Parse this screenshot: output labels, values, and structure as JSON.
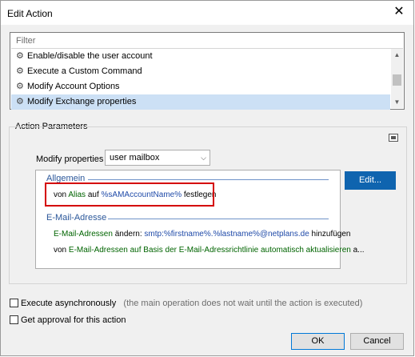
{
  "window": {
    "title": "Edit Action",
    "close_glyph": "✕"
  },
  "action_list": {
    "filter_placeholder": "Filter",
    "items": [
      {
        "label": "Enable/disable the user account",
        "selected": false
      },
      {
        "label": "Execute a Custom Command",
        "selected": false
      },
      {
        "label": "Modify Account Options",
        "selected": false
      },
      {
        "label": "Modify Exchange properties",
        "selected": true
      }
    ]
  },
  "params": {
    "group_label": "Action Parameters",
    "modify_label": "Modify properties of",
    "modify_value": "user mailbox",
    "sections": {
      "allgemein": {
        "title": "Allgemein",
        "line": {
          "p1": "von ",
          "p2": "Alias",
          "p3": " auf ",
          "p4": "%sAMAccountName%",
          "p5": " festlegen"
        }
      },
      "email": {
        "title": "E-Mail-Adresse",
        "line1": {
          "p1": "E-Mail-Adressen",
          "p2": " ändern: ",
          "p3": "smtp:%firstname%.%lastname%@netplans.de",
          "p4": " hinzufügen"
        },
        "line2": {
          "p1": "von ",
          "p2": "E-Mail-Adressen auf Basis der E-Mail-Adressrichtlinie automatisch aktualisieren",
          "p3": " a..."
        }
      }
    },
    "edit_button": "Edit..."
  },
  "options": {
    "async_label": "Execute asynchronously",
    "async_hint": "(the main operation does not wait until the action is executed)",
    "approval_label": "Get approval for this action"
  },
  "footer": {
    "ok": "OK",
    "cancel": "Cancel"
  },
  "colors": {
    "accent": "#0f64af",
    "highlight": "#d40000",
    "selection": "#cce0f5"
  }
}
